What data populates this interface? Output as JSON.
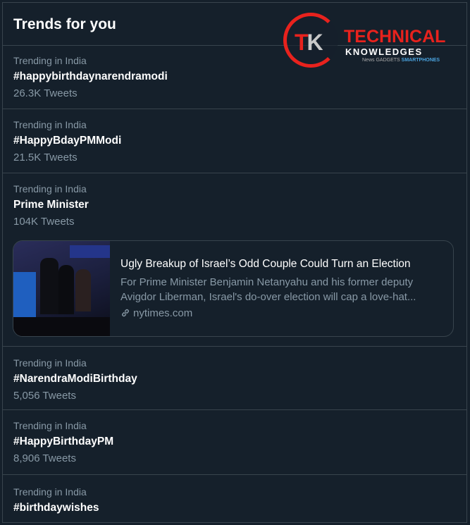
{
  "panel": {
    "title": "Trends for you"
  },
  "logo": {
    "initials_t": "T",
    "initials_k": "K",
    "line1": "TECHNICAL",
    "line2": "KNOWLEDGES",
    "line3_a": "News",
    "line3_b": "GADGETS",
    "line3_c": "SMARTPHONES"
  },
  "trends": [
    {
      "meta": "Trending in India",
      "tag": "#happybirthdaynarendramodi",
      "count": "26.3K Tweets"
    },
    {
      "meta": "Trending in India",
      "tag": "#HappyBdayPMModi",
      "count": "21.5K Tweets"
    },
    {
      "meta": "Trending in India",
      "tag": "Prime Minister",
      "count": "104K Tweets",
      "card": {
        "title": "Ugly Breakup of Israel’s Odd Couple Could Turn an Election",
        "desc1": "For Prime Minister Benjamin Netanyahu and his former deputy",
        "desc2": "Avigdor Liberman, Israel's do-over election will cap a love-hat...",
        "source": "nytimes.com"
      }
    },
    {
      "meta": "Trending in India",
      "tag": "#NarendraModiBirthday",
      "count": "5,056 Tweets"
    },
    {
      "meta": "Trending in India",
      "tag": "#HappyBirthdayPM",
      "count": "8,906 Tweets"
    },
    {
      "meta": "Trending in India",
      "tag": "#birthdaywishes"
    }
  ],
  "colors": {
    "background": "#15202b",
    "border": "#38444d",
    "muted": "#8899a6",
    "logo_red": "#e8221d"
  }
}
